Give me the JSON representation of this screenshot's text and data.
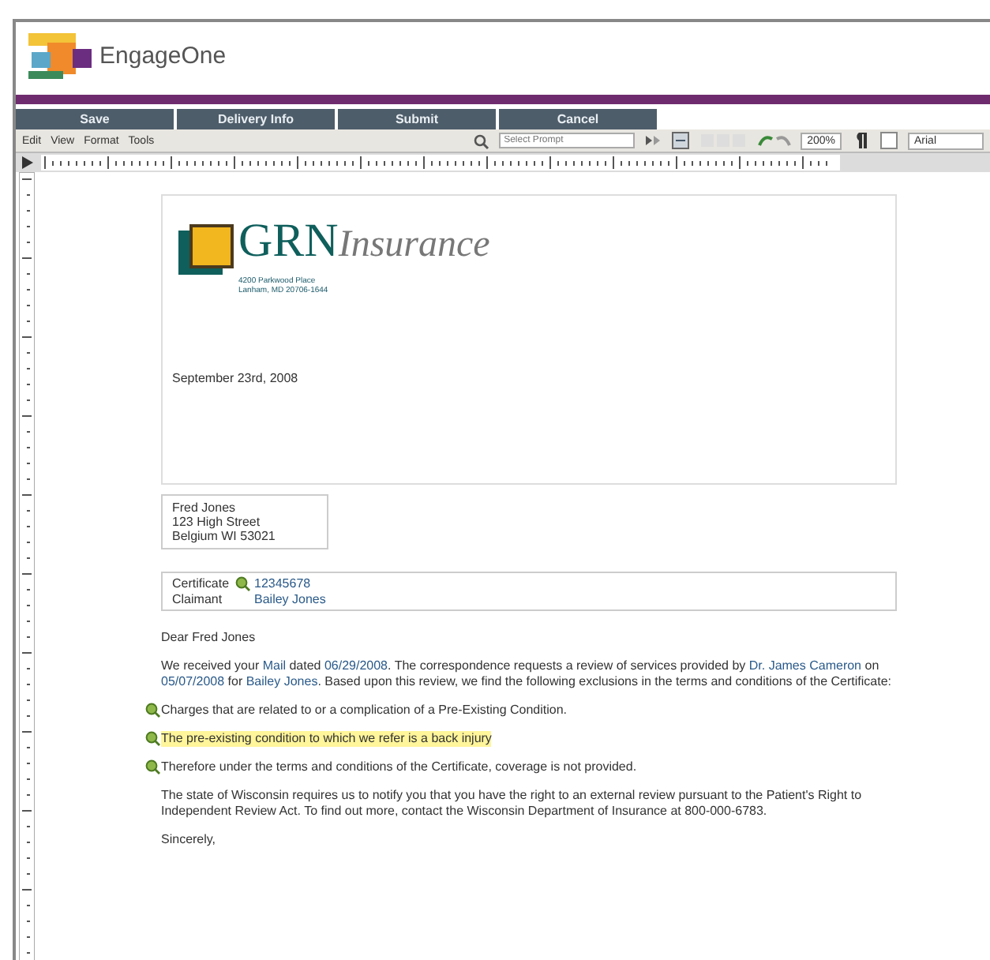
{
  "app": {
    "name": "EngageOne"
  },
  "action_buttons": [
    "Save",
    "Delivery Info",
    "Submit",
    "Cancel"
  ],
  "menu": [
    "Edit",
    "View",
    "Format",
    "Tools"
  ],
  "toolbar": {
    "prompt_placeholder": "Select Prompt",
    "zoom": "200%",
    "font": "Arial"
  },
  "letter": {
    "logo": {
      "name": "GRN",
      "suffix": "Insurance",
      "address": [
        "4200 Parkwood Place",
        "Lanham, MD 20706-1644"
      ]
    },
    "date": "September 23rd, 2008",
    "recipient": [
      "Fred Jones",
      "123 High Street",
      "Belgium WI 53021"
    ],
    "fields": [
      {
        "label": "Certificate",
        "value": "12345678",
        "pinned": true
      },
      {
        "label": "Claimant",
        "value": "Bailey Jones",
        "pinned": false
      }
    ],
    "greeting": "Dear Fred Jones",
    "paragraphs": [
      {
        "kind": "text",
        "highlighted": false,
        "segments": [
          "We received your ",
          {
            "field": "Mail"
          },
          " dated ",
          {
            "field": "06/29/2008"
          },
          ". The correspondence requests a review of services provided by ",
          {
            "field": "Dr. James Cameron"
          },
          " on ",
          {
            "field": "05/07/2008"
          },
          " for ",
          {
            "field": "Bailey Jones"
          },
          ". Based upon this review, we find the following exclusions in the terms and conditions of the Certificate:"
        ]
      },
      {
        "kind": "clause",
        "highlighted": false,
        "segments": [
          "Charges that are related to or a complication of a Pre-Existing Condition."
        ]
      },
      {
        "kind": "clause",
        "highlighted": true,
        "segments": [
          "The pre-existing condition to which we refer is a back injury"
        ]
      },
      {
        "kind": "clause",
        "highlighted": false,
        "segments": [
          "Therefore under the terms and conditions of the Certificate, coverage is not provided."
        ]
      },
      {
        "kind": "text",
        "highlighted": false,
        "segments": [
          "The state of Wisconsin requires us to notify you that you have the right to an external review pursuant to the Patient's Right to Independent Review Act. To find out more, contact the Wisconsin Department of Insurance at 800-000-6783."
        ]
      },
      {
        "kind": "text",
        "highlighted": false,
        "segments": [
          "Sincerely,"
        ]
      }
    ]
  }
}
